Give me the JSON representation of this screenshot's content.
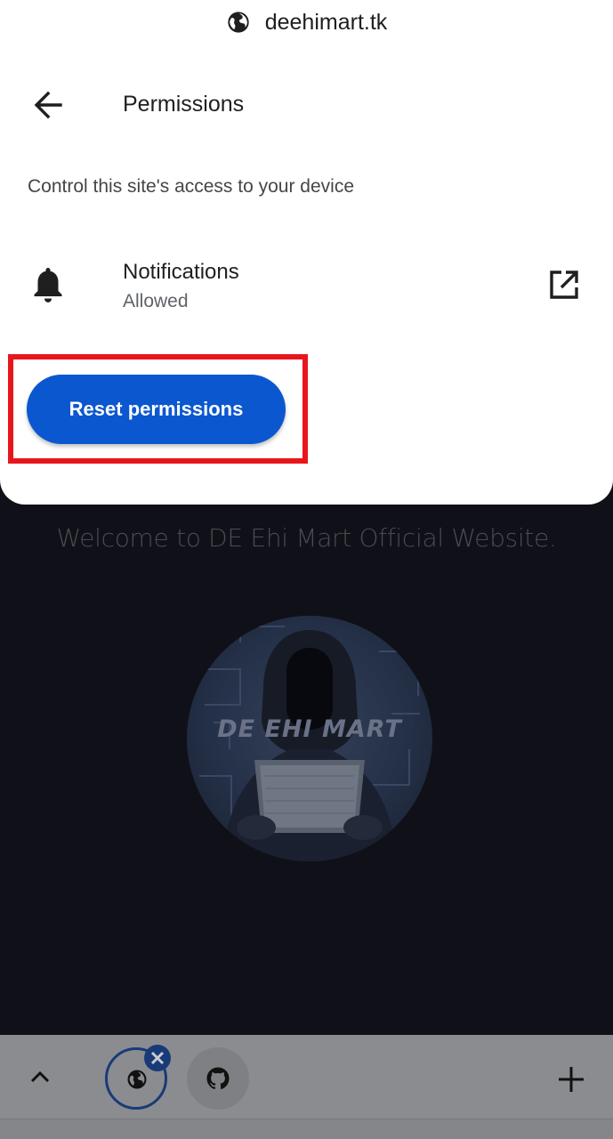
{
  "site_header": {
    "domain": "deehimart.tk",
    "icon": "globe-icon"
  },
  "permissions": {
    "title": "Permissions",
    "description": "Control this site's access to your device",
    "back_icon": "arrow-left-icon",
    "items": [
      {
        "label": "Notifications",
        "status": "Allowed",
        "icon": "bell-icon",
        "action_icon": "open-external-icon"
      }
    ],
    "reset_button_label": "Reset permissions"
  },
  "annotation": {
    "highlight_color": "#e8161c",
    "target": "reset-permissions-button"
  },
  "website": {
    "welcome_text": "Welcome to DE Ehi Mart Official Website.",
    "logo_text": "DE EHI MART"
  },
  "tab_strip": {
    "tabs": [
      {
        "icon": "globe-icon",
        "active": true,
        "close_icon": "close-icon"
      },
      {
        "icon": "github-icon",
        "active": false
      }
    ],
    "collapse_icon": "chevron-up-icon",
    "new_tab_icon": "plus-icon"
  },
  "colors": {
    "accent": "#0b57d0",
    "tab_active": "#183b78",
    "sheet": "#ffffff"
  }
}
